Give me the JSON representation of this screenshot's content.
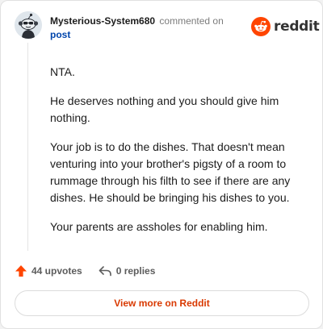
{
  "header": {
    "username": "Mysterious-System680",
    "commented_on": "commented on",
    "post_link": "post"
  },
  "brand": {
    "wordmark": "reddit",
    "accent_color": "#ff4500",
    "logo_icon": "reddit-snoo-icon"
  },
  "avatar": {
    "icon": "snoo-avatar"
  },
  "comment": {
    "paragraphs": [
      "NTA.",
      "He deserves nothing and you should give him nothing.",
      "Your job is to do the dishes. That doesn't mean venturing into your brother's pigsty of a room to rummage through his filth to see if there are any dishes. He should be bringing his dishes to you.",
      "Your parents are assholes for enabling him."
    ]
  },
  "actions": {
    "upvotes_label": "44 upvotes",
    "upvote_icon": "upvote-arrow-icon",
    "upvote_color": "#ff4500",
    "replies_label": "0 replies",
    "reply_icon": "reply-arrow-icon"
  },
  "footer": {
    "view_more_label": "View more on Reddit",
    "view_more_color": "#d93900"
  }
}
